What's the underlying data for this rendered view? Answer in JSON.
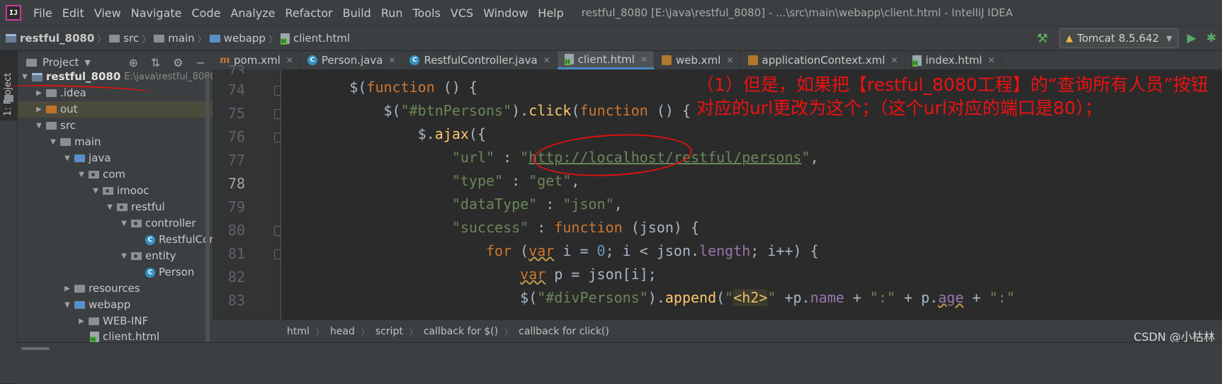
{
  "menubar": {
    "logo": "IJ",
    "items": [
      "File",
      "Edit",
      "View",
      "Navigate",
      "Code",
      "Analyze",
      "Refactor",
      "Build",
      "Run",
      "Tools",
      "VCS",
      "Window",
      "Help"
    ],
    "window_title": "restful_8080 [E:\\java\\restful_8080] - ...\\src\\main\\webapp\\client.html - IntelliJ IDEA"
  },
  "breadcrumb": [
    "restful_8080",
    "src",
    "main",
    "webapp",
    "client.html"
  ],
  "run_config": {
    "label": "Tomcat 8.5.642"
  },
  "sidebar_tab": "1: Project",
  "project_panel": {
    "title": "Project",
    "tree": [
      {
        "label": "restful_8080",
        "path": "E:\\java\\restful_8080",
        "depth": 0,
        "icon": "module-folder-icon",
        "arrow": "down"
      },
      {
        "label": ".idea",
        "depth": 1,
        "icon": "folder-icon",
        "arrow": "right"
      },
      {
        "label": "out",
        "depth": 1,
        "icon": "folder-orange-icon",
        "arrow": "right"
      },
      {
        "label": "src",
        "depth": 1,
        "icon": "folder-icon",
        "arrow": "down"
      },
      {
        "label": "main",
        "depth": 2,
        "icon": "folder-icon",
        "arrow": "down"
      },
      {
        "label": "java",
        "depth": 3,
        "icon": "folder-blue-icon",
        "arrow": "down"
      },
      {
        "label": "com",
        "depth": 4,
        "icon": "package-icon",
        "arrow": "down"
      },
      {
        "label": "imooc",
        "depth": 5,
        "icon": "package-icon",
        "arrow": "down"
      },
      {
        "label": "restful",
        "depth": 6,
        "icon": "package-icon",
        "arrow": "down"
      },
      {
        "label": "controller",
        "depth": 7,
        "icon": "package-icon",
        "arrow": "down"
      },
      {
        "label": "RestfulCor",
        "depth": 8,
        "icon": "class-icon",
        "arrow": ""
      },
      {
        "label": "entity",
        "depth": 7,
        "icon": "package-icon",
        "arrow": "down"
      },
      {
        "label": "Person",
        "depth": 8,
        "icon": "class-icon",
        "arrow": ""
      },
      {
        "label": "resources",
        "depth": 3,
        "icon": "folder-icon",
        "arrow": "right"
      },
      {
        "label": "webapp",
        "depth": 3,
        "icon": "web-folder-icon",
        "arrow": "down"
      },
      {
        "label": "WEB-INF",
        "depth": 4,
        "icon": "folder-icon",
        "arrow": "right"
      },
      {
        "label": "client.html",
        "depth": 4,
        "icon": "html-file-icon",
        "arrow": ""
      }
    ]
  },
  "tabs": [
    {
      "label": "pom.xml",
      "icon": "maven-icon",
      "active": false
    },
    {
      "label": "Person.java",
      "icon": "class-icon",
      "active": false
    },
    {
      "label": "RestfulController.java",
      "icon": "class-icon",
      "active": false
    },
    {
      "label": "client.html",
      "icon": "html-file-icon",
      "active": true
    },
    {
      "label": "web.xml",
      "icon": "xml-icon",
      "active": false
    },
    {
      "label": "applicationContext.xml",
      "icon": "xml-icon",
      "active": false
    },
    {
      "label": "index.html",
      "icon": "html-file-icon",
      "active": false
    }
  ],
  "editor": {
    "current_line": 78,
    "lines": [
      {
        "no": 73,
        "code": ""
      },
      {
        "no": 74,
        "code": "        $(function () {"
      },
      {
        "no": 75,
        "code": "            $(\"#btnPersons\").click(function () {"
      },
      {
        "no": 76,
        "code": "                $.ajax({"
      },
      {
        "no": 77,
        "code": "                    \"url\" : \"http://localhost/restful/persons\","
      },
      {
        "no": 78,
        "code": "                    \"type\" : \"get\","
      },
      {
        "no": 79,
        "code": "                    \"dataType\" : \"json\","
      },
      {
        "no": 80,
        "code": "                    \"success\" : function (json) {"
      },
      {
        "no": 81,
        "code": "                        for (var i = 0; i < json.length; i++) {"
      },
      {
        "no": 82,
        "code": "                            var p = json[i];"
      },
      {
        "no": 83,
        "code": "                            $(\"#divPersons\").append(\"<h2>\" +p.name + \":\" + p.age + \":\""
      }
    ]
  },
  "annotation": "（1）但是，如果把【restful_8080工程】的“查询所有人员”按钮对应的url更改为这个；（这个url对应的端口是80）；",
  "status_breadcrumb": [
    "html",
    "head",
    "script",
    "callback for $()",
    "callback for click()"
  ],
  "watermark": "CSDN @小枯林",
  "colors": {
    "keyword": "#cc7832",
    "string": "#6a8759",
    "number": "#6897bb",
    "function": "#ffc66d",
    "property": "#9876aa",
    "annotation_red": "#ee1111",
    "active_tab_underline": "#4a88c7"
  }
}
